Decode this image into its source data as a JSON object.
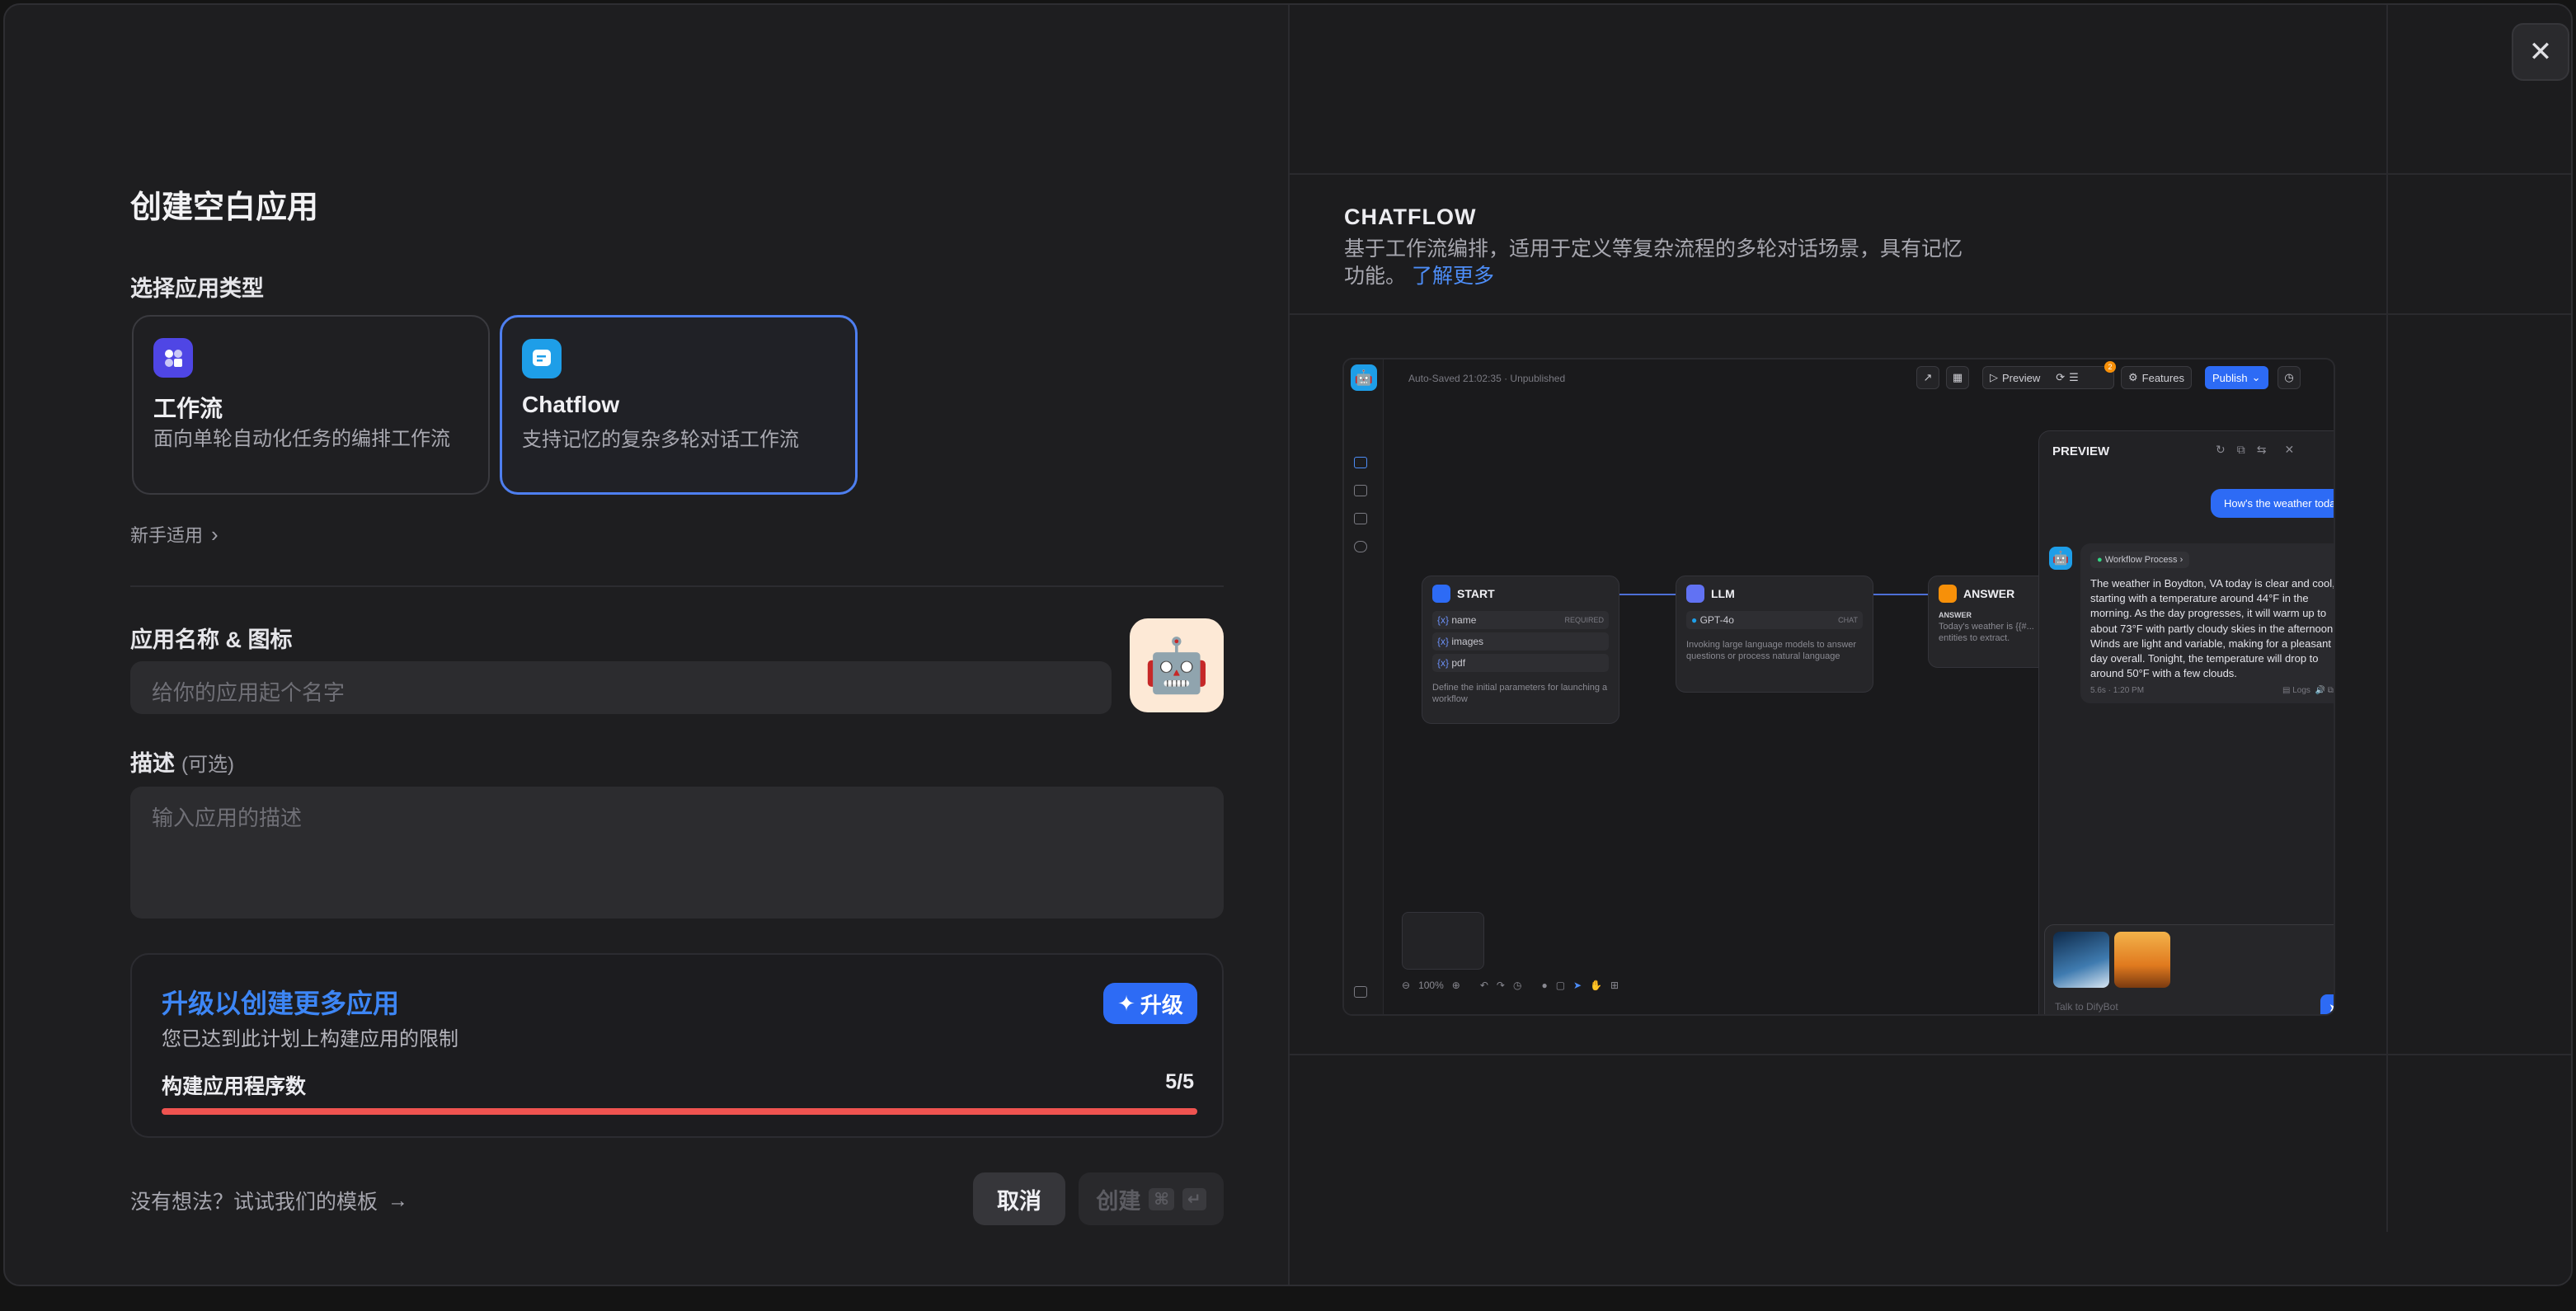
{
  "dialog": {
    "title": "创建空白应用",
    "choose_type_label": "选择应用类型",
    "app_types": [
      {
        "name": "工作流",
        "desc": "面向单轮自动化任务的编排工作流",
        "selected": false
      },
      {
        "name": "Chatflow",
        "desc": "支持记忆的复杂多轮对话工作流",
        "selected": true
      }
    ],
    "beginner_link": "新手适用",
    "name_icon_label": "应用名称 & 图标",
    "name_placeholder": "给你的应用起个名字",
    "icon_emoji": "🤖",
    "desc_label": "描述",
    "desc_optional": "(可选)",
    "desc_placeholder": "输入应用的描述",
    "upgrade": {
      "title": "升级以创建更多应用",
      "subtitle": "您已达到此计划上构建应用的限制",
      "button": "升级",
      "count_label": "构建应用程序数",
      "count_value": "5/5",
      "progress": 1.0
    },
    "template_link": "没有想法？试试我们的模板",
    "cancel": "取消",
    "create": "创建",
    "create_shortcut": [
      "⌘",
      "↵"
    ]
  },
  "preview_panel": {
    "title": "CHATFLOW",
    "desc": "基于工作流编排，适用于定义等复杂流程的多轮对话场景，具有记忆功能。",
    "learn_more": "了解更多"
  },
  "mini": {
    "status": "Auto-Saved 21:02:35 · Unpublished",
    "preview_btn": "Preview",
    "badge": "2",
    "features_btn": "Features",
    "publish_btn": "Publish",
    "nodes": {
      "start": {
        "title": "START",
        "vars": [
          "name",
          "images",
          "pdf"
        ],
        "required": "REQUIRED",
        "desc": "Define the initial parameters for launching a workflow"
      },
      "llm": {
        "title": "LLM",
        "model": "GPT-4o",
        "mode": "CHAT",
        "desc": "Invoking large language models to answer questions or process natural language"
      },
      "answer": {
        "title": "ANSWER",
        "label": "ANSWER",
        "text": "Today's weather is {{#...",
        "text2": "entities to extract."
      }
    },
    "zoom": "100%",
    "chat": {
      "title": "PREVIEW",
      "user_msg": "How's the weather today",
      "process": "Workflow Process",
      "reply": "The weather in Boydton, VA today is clear and cool, starting with a temperature around 44°F in the morning. As the day progresses, it will warm up to about 73°F with partly cloudy skies in the afternoon. Winds are light and variable, making for a pleasant day overall. Tonight, the temperature will drop to around 50°F with a few clouds.",
      "meta": "5.6s · 1:20 PM",
      "logs": "Logs",
      "placeholder": "Talk to DifyBot"
    }
  },
  "colors": {
    "accent": "#2d6bf5",
    "progress": "#ef5350",
    "link": "#4d8df7"
  }
}
